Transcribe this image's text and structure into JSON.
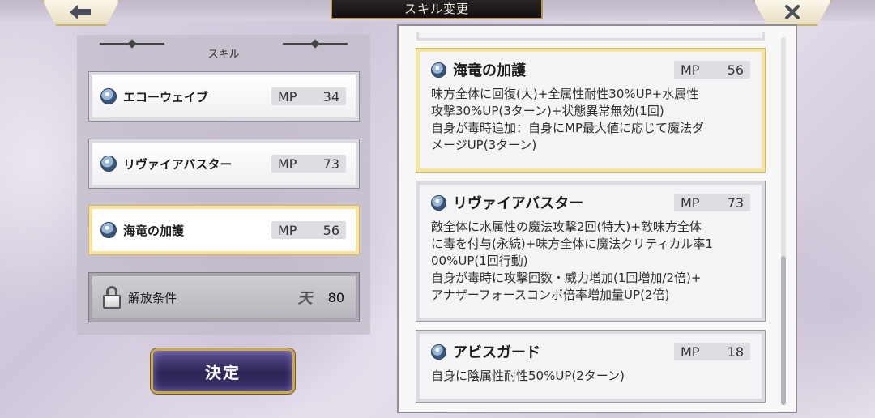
{
  "header": {
    "title": "スキル変更",
    "back_icon": "back-arrow-icon",
    "close_icon": "close-x-icon"
  },
  "skill_list": {
    "heading": "スキル",
    "items": [
      {
        "name": "エコーウェイブ",
        "mp_label": "MP",
        "mp": "34",
        "selected": false
      },
      {
        "name": "リヴァイアバスター",
        "mp_label": "MP",
        "mp": "73",
        "selected": false
      },
      {
        "name": "海竜の加護",
        "mp_label": "MP",
        "mp": "56",
        "selected": true
      }
    ],
    "unlock": {
      "label": "解放条件",
      "icon": "ten-icon",
      "icon_glyph": "天",
      "value": "80"
    }
  },
  "decide_button": {
    "label": "決定"
  },
  "details": [
    {
      "name": "海竜の加護",
      "mp_label": "MP",
      "mp": "56",
      "selected": true,
      "description": "味方全体に回復(大)+全属性耐性30%UP+水属性\n攻撃30%UP(3ターン)+状態異常無効(1回)\n自身が毒時追加：自身にMP最大値に応じて魔法ダ\nメージUP(3ターン)"
    },
    {
      "name": "リヴァイアバスター",
      "mp_label": "MP",
      "mp": "73",
      "selected": false,
      "description": "敵全体に水属性の魔法攻撃2回(特大)+敵味方全体\nに毒を付与(永続)+味方全体に魔法クリティカル率1\n00%UP(1回行動)\n自身が毒時に攻撃回数・威力増加(1回増加/2倍)+\nアナザーフォースコンボ倍率増加量UP(2倍)"
    },
    {
      "name": "アビスガード",
      "mp_label": "MP",
      "mp": "18",
      "selected": false,
      "description": "自身に陰属性耐性50%UP(2ターン)"
    }
  ],
  "colors": {
    "selected_border": "#f5e3a2",
    "gold_trim": "#c9a94e",
    "decide_button_bg": "#2e2556"
  }
}
